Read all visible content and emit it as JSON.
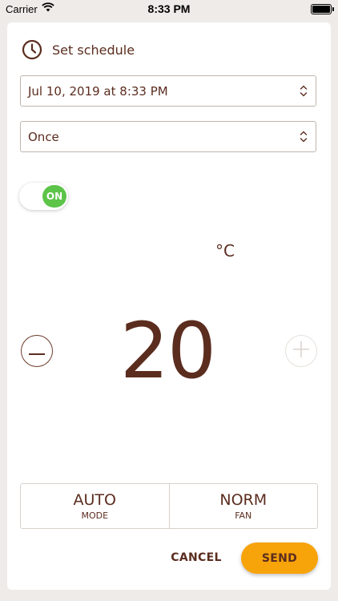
{
  "status_bar": {
    "carrier": "Carrier",
    "time": "8:33 PM",
    "icons": [
      "wifi-icon",
      "battery-icon"
    ]
  },
  "header": {
    "title": "Set schedule",
    "icon": "clock-icon"
  },
  "date_field": {
    "value": "Jul 10, 2019 at 8:33 PM",
    "icon": "chevron-up-down-icon"
  },
  "repeat_field": {
    "value": "Once",
    "icon": "chevron-up-down-icon"
  },
  "power_toggle": {
    "label": "ON",
    "state": true,
    "color": "#5cc449"
  },
  "temperature": {
    "unit": "°C",
    "value": "20",
    "decrease_icon": "minus-icon",
    "increase_icon": "plus-icon"
  },
  "mode_bar": {
    "mode_value": "AUTO",
    "mode_label": "MODE",
    "fan_value": "NORM",
    "fan_label": "FAN"
  },
  "actions": {
    "cancel_label": "CANCEL",
    "send_label": "SEND"
  },
  "colors": {
    "primary_text": "#5b2d1f",
    "accent": "#f7a30a",
    "toggle_on": "#5cc449",
    "background": "#efebe8"
  }
}
